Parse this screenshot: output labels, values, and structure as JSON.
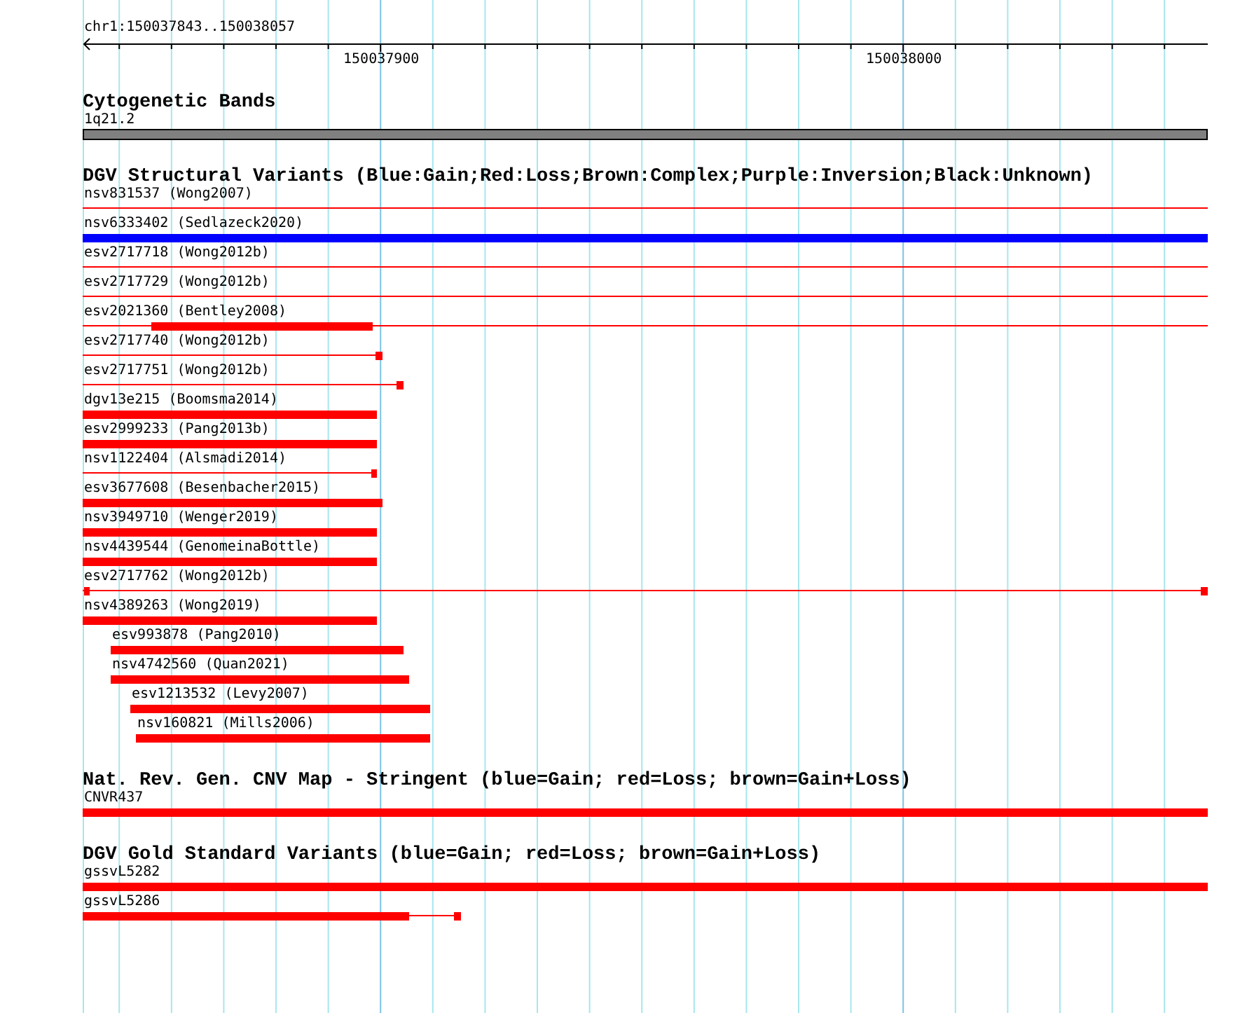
{
  "ruler": {
    "location": "chr1:150037843..150038057",
    "ticks": [
      "150037900",
      "150038000"
    ]
  },
  "tracks": [
    {
      "title": "Cytogenetic Bands",
      "features": [
        {
          "label": "1q21.2",
          "color": "#808080"
        }
      ]
    },
    {
      "title": "DGV Structural Variants (Blue:Gain;Red:Loss;Brown:Complex;Purple:Inversion;Black:Unknown)",
      "features": [
        {
          "label": "nsv831537 (Wong2007)",
          "color": "#ff0000"
        },
        {
          "label": "nsv6333402 (Sedlazeck2020)",
          "color": "#0000ff"
        },
        {
          "label": "esv2717718 (Wong2012b)",
          "color": "#ff0000"
        },
        {
          "label": "esv2717729 (Wong2012b)",
          "color": "#ff0000"
        },
        {
          "label": "esv2021360 (Bentley2008)",
          "color": "#ff0000"
        },
        {
          "label": "esv2717740 (Wong2012b)",
          "color": "#ff0000"
        },
        {
          "label": "esv2717751 (Wong2012b)",
          "color": "#ff0000"
        },
        {
          "label": "dgv13e215 (Boomsma2014)",
          "color": "#ff0000"
        },
        {
          "label": "esv2999233 (Pang2013b)",
          "color": "#ff0000"
        },
        {
          "label": "nsv1122404 (Alsmadi2014)",
          "color": "#ff0000"
        },
        {
          "label": "esv3677608 (Besenbacher2015)",
          "color": "#ff0000"
        },
        {
          "label": "nsv3949710 (Wenger2019)",
          "color": "#ff0000"
        },
        {
          "label": "nsv4439544 (GenomeinaBottle)",
          "color": "#ff0000"
        },
        {
          "label": "esv2717762 (Wong2012b)",
          "color": "#ff0000"
        },
        {
          "label": "nsv4389263 (Wong2019)",
          "color": "#ff0000"
        },
        {
          "label": "esv993878 (Pang2010)",
          "color": "#ff0000"
        },
        {
          "label": "nsv4742560 (Quan2021)",
          "color": "#ff0000"
        },
        {
          "label": "esv1213532 (Levy2007)",
          "color": "#ff0000"
        },
        {
          "label": "nsv160821 (Mills2006)",
          "color": "#ff0000"
        }
      ]
    },
    {
      "title": "Nat. Rev. Gen. CNV Map - Stringent (blue=Gain; red=Loss; brown=Gain+Loss)",
      "features": [
        {
          "label": "CNVR437",
          "color": "#ff0000"
        }
      ]
    },
    {
      "title": "DGV Gold Standard Variants (blue=Gain; red=Loss; brown=Gain+Loss)",
      "features": [
        {
          "label": "gssvL5282",
          "color": "#ff0000"
        },
        {
          "label": "gssvL5286",
          "color": "#ff0000"
        }
      ]
    }
  ]
}
